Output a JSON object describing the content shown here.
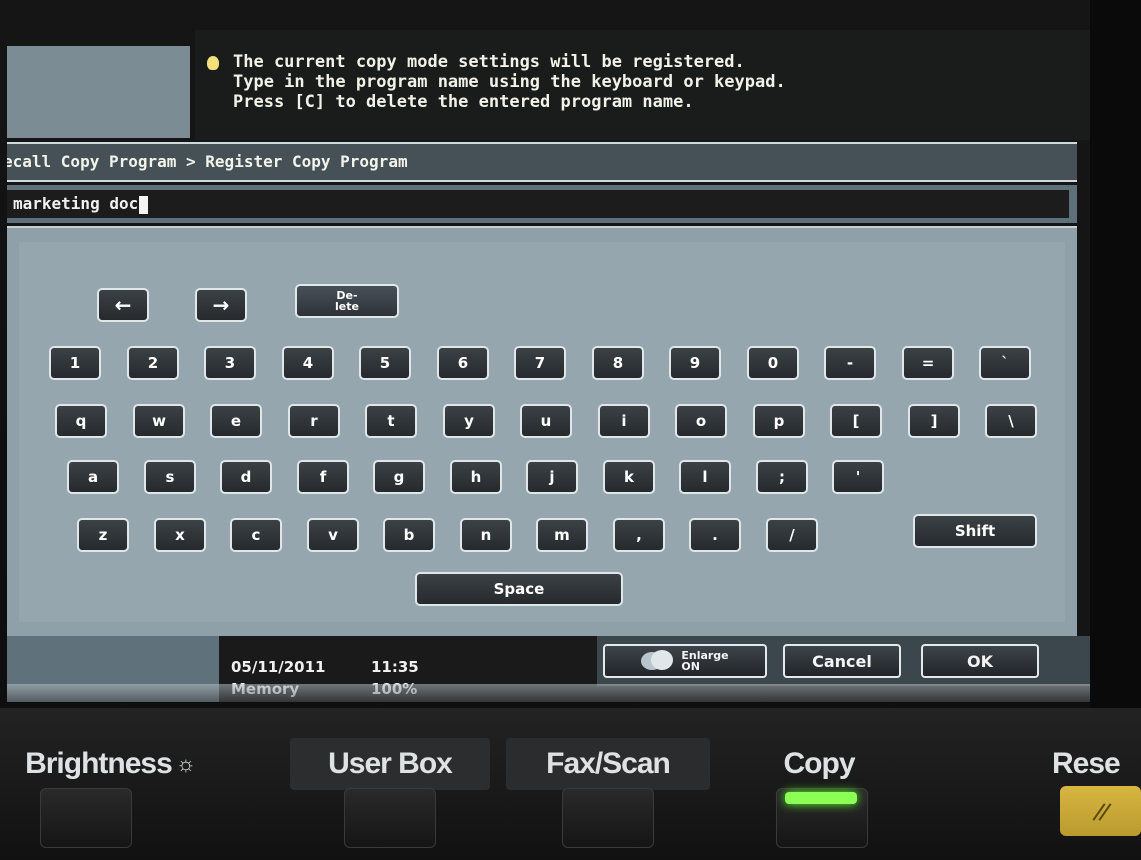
{
  "message": {
    "lines": [
      "The current copy mode settings will be registered.",
      "Type in the program name using the keyboard or keypad.",
      "Press [C] to delete the entered program name."
    ]
  },
  "breadcrumb": "ecall Copy Program > Register Copy Program",
  "input": {
    "value": "marketing doc"
  },
  "keyboard": {
    "nav": {
      "left": "←",
      "right": "→",
      "delete": "De-\nlete"
    },
    "row1": [
      "1",
      "2",
      "3",
      "4",
      "5",
      "6",
      "7",
      "8",
      "9",
      "0",
      "-",
      "=",
      "`"
    ],
    "row2": [
      "q",
      "w",
      "e",
      "r",
      "t",
      "y",
      "u",
      "i",
      "o",
      "p",
      "[",
      "]",
      "\\"
    ],
    "row3": [
      "a",
      "s",
      "d",
      "f",
      "g",
      "h",
      "j",
      "k",
      "l",
      ";",
      "'"
    ],
    "row4": [
      "z",
      "x",
      "c",
      "v",
      "b",
      "n",
      "m",
      ",",
      ".",
      "/"
    ],
    "shift": "Shift",
    "space": "Space"
  },
  "status": {
    "date": "05/11/2011",
    "time": "11:35",
    "memory_label": "Memory",
    "memory_value": "100%"
  },
  "buttons": {
    "enlarge": "Enlarge\nON",
    "cancel": "Cancel",
    "ok": "OK"
  },
  "panel": {
    "brightness": "Brightness",
    "user_box": "User Box",
    "fax_scan": "Fax/Scan",
    "copy": "Copy",
    "reset": "Rese"
  }
}
